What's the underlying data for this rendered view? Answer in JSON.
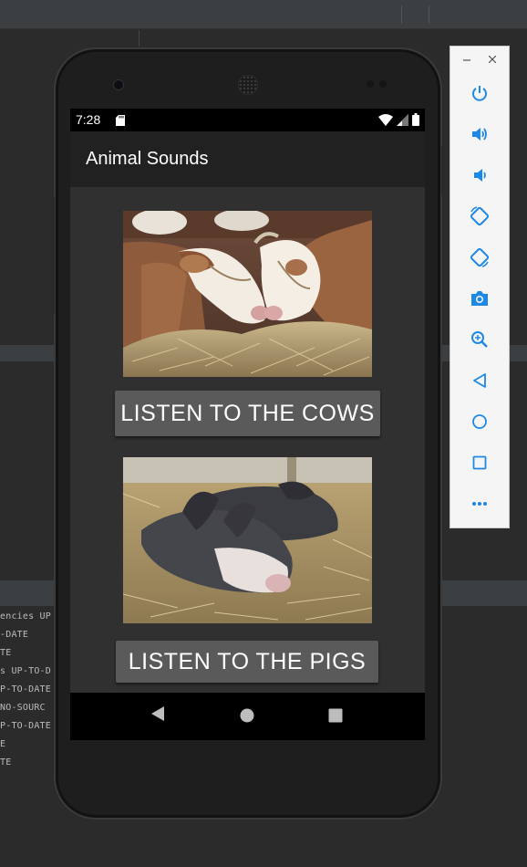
{
  "ide": {
    "console_lines": [
      "encies UP",
      "-DATE",
      "TE",
      "s UP-TO-D",
      "P-TO-DATE",
      " NO-SOURC",
      "P-TO-DATE",
      "E",
      "TE"
    ]
  },
  "device": {
    "status_bar": {
      "time": "7:28",
      "icons": [
        "sd-card-icon",
        "wifi-icon",
        "cell-signal-icon",
        "battery-icon"
      ]
    },
    "app_bar": {
      "title": "Animal Sounds"
    },
    "content": {
      "cows_image": "cows-photo",
      "cows_button": "LISTEN TO THE COWS",
      "pigs_image": "pigs-photo",
      "pigs_button": "LISTEN TO THE PIGS"
    },
    "nav_bar": {
      "buttons": [
        "back-icon",
        "home-icon",
        "recents-icon"
      ]
    }
  },
  "emulator_panel": {
    "window_controls": [
      "minimize-icon",
      "close-icon"
    ],
    "controls": [
      "power-icon",
      "volume-up-icon",
      "volume-down-icon",
      "rotate-left-icon",
      "rotate-right-icon",
      "camera-icon",
      "zoom-icon",
      "back-icon",
      "home-icon",
      "overview-icon",
      "more-icon"
    ]
  },
  "colors": {
    "app_bar": "#212121",
    "screen_bg": "#303030",
    "button_bg": "#5a5a5a",
    "emulator_icon": "#1e88e5"
  }
}
